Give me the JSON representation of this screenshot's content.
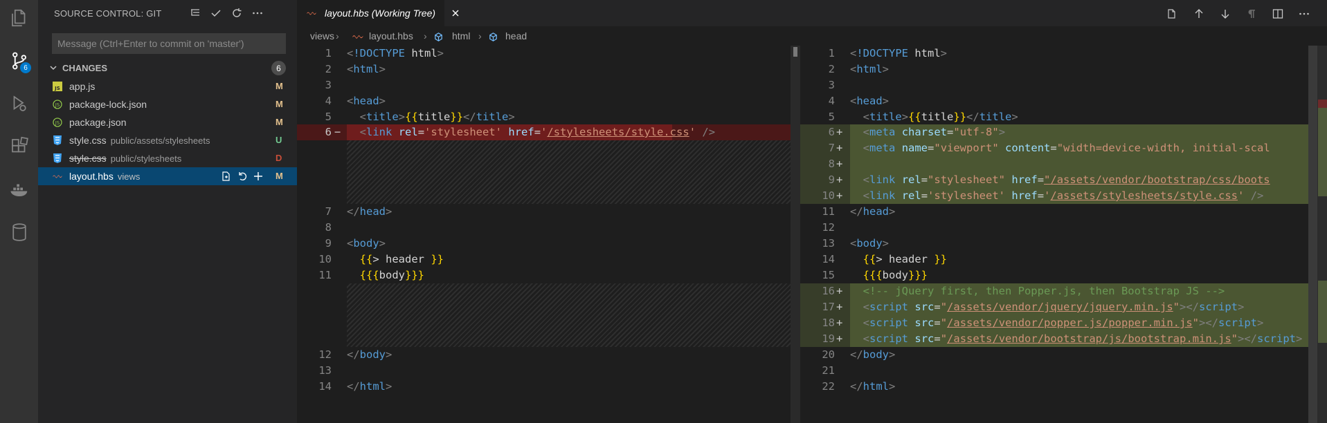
{
  "activity_bar": {
    "scm_badge": "6",
    "items": [
      "explorer-icon",
      "source-control-icon",
      "run-debug-icon",
      "extensions-icon",
      "docker-icon",
      "database-icon"
    ]
  },
  "sidebar": {
    "title": "SOURCE CONTROL: GIT",
    "actions": [
      "view-as-tree-icon",
      "commit-check-icon",
      "refresh-icon",
      "more-actions-icon"
    ],
    "message_placeholder": "Message (Ctrl+Enter to commit on 'master')",
    "changes_label": "CHANGES",
    "changes_count": "6",
    "files": [
      {
        "name": "app.js",
        "dir": "",
        "status": "M",
        "icon": "js-file-icon"
      },
      {
        "name": "package-lock.json",
        "dir": "",
        "status": "M",
        "icon": "json-file-icon"
      },
      {
        "name": "package.json",
        "dir": "",
        "status": "M",
        "icon": "json-file-icon"
      },
      {
        "name": "style.css",
        "dir": "public/assets/stylesheets",
        "status": "U",
        "icon": "css-file-icon"
      },
      {
        "name": "style.css",
        "dir": "public/stylesheets",
        "status": "D",
        "icon": "css-file-icon"
      },
      {
        "name": "layout.hbs",
        "dir": "views",
        "status": "M",
        "icon": "handlebars-file-icon"
      }
    ],
    "status_colors": {
      "M": "#e2c08d",
      "U": "#73c991",
      "D": "#c74e39"
    }
  },
  "editor": {
    "tab_title": "layout.hbs (Working Tree)",
    "breadcrumb": [
      "views",
      "layout.hbs",
      "html",
      "head"
    ],
    "actions": [
      "open-file-icon",
      "previous-change-icon",
      "next-change-icon",
      "show-whitespace-icon",
      "split-editor-icon",
      "more-actions-icon"
    ],
    "left_line_numbers": {
      "n1": "1",
      "n2": "2",
      "n3": "3",
      "n4": "4",
      "n5": "5",
      "n6": "6",
      "n7": "7",
      "n8": "8",
      "n9": "9",
      "n10": "10",
      "n11": "11",
      "n12": "12",
      "n13": "13",
      "n14": "14"
    },
    "right_line_numbers": {
      "n1": "1",
      "n2": "2",
      "n3": "3",
      "n4": "4",
      "n5": "5",
      "n6": "6",
      "n7": "7",
      "n8": "8",
      "n9": "9",
      "n10": "10",
      "n11": "11",
      "n12": "12",
      "n13": "13",
      "n14": "14",
      "n15": "15",
      "n16": "16",
      "n17": "17",
      "n18": "18",
      "n19": "19",
      "n20": "20",
      "n21": "21",
      "n22": "22"
    },
    "left": {
      "doctype_kw": "!DOCTYPE",
      "doctype_name": " html",
      "html": "html",
      "head": "head",
      "title": "title",
      "title_var": "title",
      "link": "link",
      "rel_attr": "rel",
      "rel_val": "'stylesheet'",
      "href_attr": "href",
      "href_val": "/stylesheets/style.css",
      "body": "body",
      "partial": " header ",
      "body_var": "body"
    },
    "right": {
      "meta": "meta",
      "charset_attr": "charset",
      "charset_val": "\"utf-8\"",
      "name_attr": "name",
      "name_val": "\"viewport\"",
      "content_attr": "content",
      "content_val": "\"width=device-width, initial-scal",
      "link1_val": "\"/assets/vendor/bootstrap/css/boots",
      "link2_val": "/assets/stylesheets/style.css",
      "comment": "<!-- jQuery first, then Popper.js, then Bootstrap JS -->",
      "script": "script",
      "src_attr": "src",
      "src1": "/assets/vendor/jquery/jquery.min.js",
      "src2": "/assets/vendor/popper.js/popper.min.js",
      "src3": "/assets/vendor/bootstrap/js/bootstrap.min.js"
    }
  }
}
